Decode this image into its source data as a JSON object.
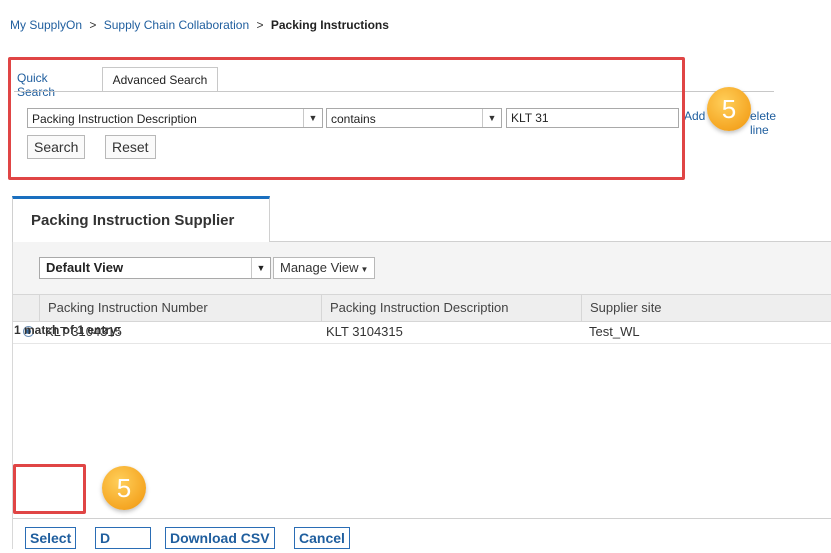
{
  "breadcrumb": {
    "items": [
      "My SupplyOn",
      "Supply Chain Collaboration"
    ],
    "current": "Packing Instructions",
    "separator": ">"
  },
  "search": {
    "tabs": {
      "quick": "Quick Search",
      "advanced": "Advanced Search"
    },
    "field": "Packing Instruction Description",
    "operator": "contains",
    "value": "KLT 31",
    "add_line": "Add",
    "delete_line": "elete line",
    "search_button": "Search",
    "reset_button": "Reset"
  },
  "annotations": {
    "step_badge_1": "5",
    "step_badge_2": "5"
  },
  "results": {
    "tab_label": "Packing Instruction Supplier",
    "view": "Default View",
    "manage_view": "Manage View",
    "columns": [
      "Packing Instruction Number",
      "Packing Instruction Description",
      "Supplier site"
    ],
    "rows": [
      {
        "number": "KLT 3104315",
        "description": "KLT 3104315",
        "site": "Test_WL"
      }
    ],
    "buttons": {
      "select": "Select",
      "d_partial": "D",
      "download_csv": "Download CSV",
      "cancel": "Cancel"
    },
    "match_text": "1 match of 1 entry:"
  },
  "colors": {
    "accent": "#1a6fbf",
    "link": "#1f5e9e",
    "highlight": "#e04545",
    "badge": "#f5a623"
  },
  "icons": {
    "dropdown": "chevron-down-icon",
    "radio": "radio-selected-icon"
  }
}
